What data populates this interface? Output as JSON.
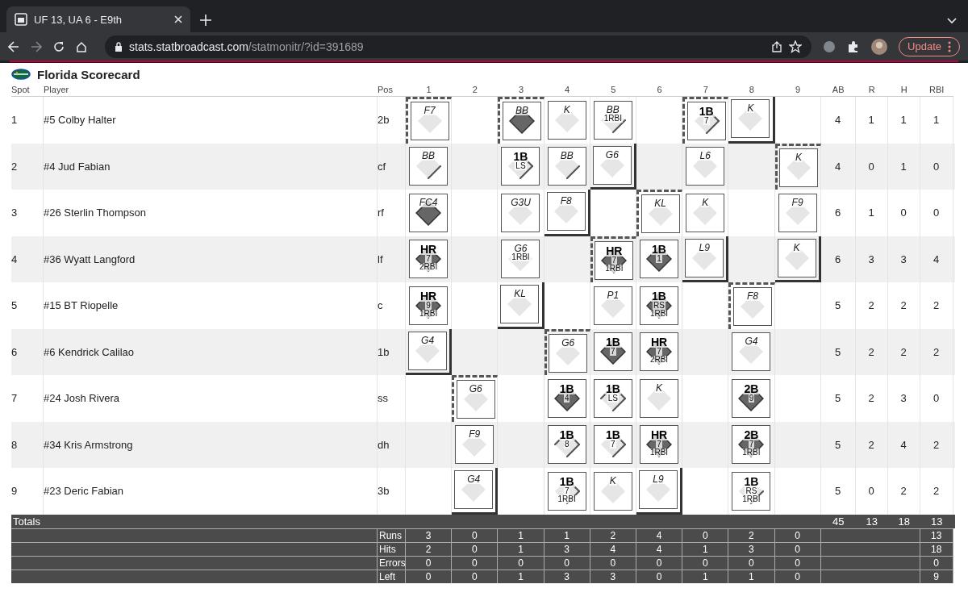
{
  "browser": {
    "tab_title": "UF 13, UA 6 - E9th",
    "url_host": "stats.statbroadcast.com",
    "url_path": "/statmonitr/?id=391689",
    "update_label": "Update"
  },
  "scorecard": {
    "title": "Florida Scorecard",
    "columns": [
      "Spot",
      "Player",
      "Pos",
      "1",
      "2",
      "3",
      "4",
      "5",
      "6",
      "7",
      "8",
      "9",
      "AB",
      "R",
      "H",
      "RBI"
    ],
    "rows": [
      {
        "spot": "1",
        "player": "#5 Colby Halter",
        "pos": "2b",
        "ab": "4",
        "r": "1",
        "h": "1",
        "rbi": "1",
        "innings": [
          {
            "kind": "out",
            "result": "F7",
            "scored": false,
            "leadoff": true,
            "third_out": false
          },
          {
            "kind": "empty",
            "leadoff": false,
            "third_out": false
          },
          {
            "kind": "walk",
            "result": "BB",
            "scored": true,
            "leadoff": true,
            "third_out": false
          },
          {
            "kind": "out",
            "result": "K",
            "scored": false,
            "leadoff": false,
            "third_out": false
          },
          {
            "kind": "walk",
            "result": "BB",
            "lines": [
              "1RBI"
            ],
            "to_first": true,
            "to_second": false,
            "to_third": false,
            "scored": false,
            "leadoff": false,
            "third_out": false
          },
          {
            "kind": "empty",
            "leadoff": false,
            "third_out": false
          },
          {
            "kind": "hit",
            "result": "1B",
            "lines": [
              "7"
            ],
            "to_first": true,
            "to_second": true,
            "to_third": false,
            "scored": false,
            "leadoff": true,
            "third_out": false
          },
          {
            "kind": "out",
            "result": "K",
            "scored": false,
            "leadoff": false,
            "third_out": true
          },
          {
            "kind": "empty",
            "leadoff": false,
            "third_out": false
          }
        ]
      },
      {
        "spot": "2",
        "player": "#4 Jud Fabian",
        "pos": "cf",
        "ab": "4",
        "r": "0",
        "h": "1",
        "rbi": "0",
        "innings": [
          {
            "kind": "walk",
            "result": "BB",
            "to_first": true,
            "to_second": false,
            "to_third": false,
            "scored": false,
            "leadoff": false,
            "third_out": false
          },
          {
            "kind": "empty",
            "leadoff": false,
            "third_out": false
          },
          {
            "kind": "hit",
            "result": "1B",
            "lines": [
              "LS"
            ],
            "to_first": true,
            "to_second": true,
            "to_third": false,
            "scored": false,
            "leadoff": false,
            "third_out": false
          },
          {
            "kind": "walk",
            "result": "BB",
            "to_first": true,
            "to_second": false,
            "to_third": false,
            "scored": false,
            "leadoff": false,
            "third_out": false
          },
          {
            "kind": "out",
            "result": "G6",
            "scored": false,
            "leadoff": false,
            "third_out": true
          },
          {
            "kind": "empty",
            "leadoff": false,
            "third_out": false
          },
          {
            "kind": "out",
            "result": "L6",
            "scored": false,
            "leadoff": false,
            "third_out": false
          },
          {
            "kind": "empty",
            "leadoff": false,
            "third_out": false
          },
          {
            "kind": "out",
            "result": "K",
            "scored": false,
            "leadoff": true,
            "third_out": false
          }
        ]
      },
      {
        "spot": "3",
        "player": "#26 Sterlin Thompson",
        "pos": "rf",
        "ab": "6",
        "r": "1",
        "h": "0",
        "rbi": "0",
        "innings": [
          {
            "kind": "out",
            "result": "FC4",
            "scored": true,
            "leadoff": false,
            "third_out": false
          },
          {
            "kind": "empty",
            "leadoff": false,
            "third_out": false
          },
          {
            "kind": "out",
            "result": "G3U",
            "scored": false,
            "leadoff": false,
            "third_out": false
          },
          {
            "kind": "out",
            "result": "F8",
            "scored": false,
            "leadoff": false,
            "third_out": true
          },
          {
            "kind": "empty",
            "leadoff": false,
            "third_out": false
          },
          {
            "kind": "out",
            "result": "KL",
            "scored": false,
            "leadoff": true,
            "third_out": false
          },
          {
            "kind": "out",
            "result": "K",
            "scored": false,
            "leadoff": false,
            "third_out": false
          },
          {
            "kind": "empty",
            "leadoff": false,
            "third_out": false
          },
          {
            "kind": "out",
            "result": "F9",
            "scored": false,
            "leadoff": false,
            "third_out": false
          }
        ]
      },
      {
        "spot": "4",
        "player": "#36 Wyatt Langford",
        "pos": "lf",
        "ab": "6",
        "r": "3",
        "h": "3",
        "rbi": "4",
        "innings": [
          {
            "kind": "hit",
            "result": "HR",
            "lines": [
              "7",
              "2RBI"
            ],
            "scored": true,
            "leadoff": false,
            "third_out": false
          },
          {
            "kind": "empty",
            "leadoff": false,
            "third_out": false
          },
          {
            "kind": "out",
            "result": "G6",
            "lines": [
              "1RBI"
            ],
            "scored": false,
            "leadoff": false,
            "third_out": false
          },
          {
            "kind": "empty",
            "leadoff": false,
            "third_out": false
          },
          {
            "kind": "hit",
            "result": "HR",
            "lines": [
              "7",
              "1RBI"
            ],
            "scored": true,
            "leadoff": true,
            "third_out": false
          },
          {
            "kind": "hit",
            "result": "1B",
            "lines": [
              "1"
            ],
            "scored": true,
            "leadoff": false,
            "third_out": false
          },
          {
            "kind": "out",
            "result": "L9",
            "scored": false,
            "leadoff": false,
            "third_out": true
          },
          {
            "kind": "empty",
            "leadoff": false,
            "third_out": false
          },
          {
            "kind": "out",
            "result": "K",
            "scored": false,
            "leadoff": false,
            "third_out": true
          }
        ]
      },
      {
        "spot": "5",
        "player": "#15 BT Riopelle",
        "pos": "c",
        "ab": "5",
        "r": "2",
        "h": "2",
        "rbi": "2",
        "innings": [
          {
            "kind": "hit",
            "result": "HR",
            "lines": [
              "9",
              "1RBI"
            ],
            "scored": true,
            "leadoff": false,
            "third_out": false
          },
          {
            "kind": "empty",
            "leadoff": false,
            "third_out": false
          },
          {
            "kind": "out",
            "result": "KL",
            "scored": false,
            "leadoff": false,
            "third_out": true
          },
          {
            "kind": "empty",
            "leadoff": false,
            "third_out": false
          },
          {
            "kind": "out",
            "result": "P1",
            "scored": false,
            "leadoff": false,
            "third_out": false
          },
          {
            "kind": "hit",
            "result": "1B",
            "lines": [
              "RS",
              "1RBI"
            ],
            "scored": true,
            "leadoff": false,
            "third_out": false
          },
          {
            "kind": "empty",
            "leadoff": false,
            "third_out": false
          },
          {
            "kind": "out",
            "result": "F8",
            "scored": false,
            "leadoff": true,
            "third_out": false
          },
          {
            "kind": "empty",
            "leadoff": false,
            "third_out": false
          }
        ]
      },
      {
        "spot": "6",
        "player": "#6 Kendrick Calilao",
        "pos": "1b",
        "ab": "5",
        "r": "2",
        "h": "2",
        "rbi": "2",
        "innings": [
          {
            "kind": "out",
            "result": "G4",
            "scored": false,
            "leadoff": false,
            "third_out": true
          },
          {
            "kind": "empty",
            "leadoff": false,
            "third_out": false
          },
          {
            "kind": "empty",
            "leadoff": false,
            "third_out": false
          },
          {
            "kind": "out",
            "result": "G6",
            "scored": false,
            "leadoff": true,
            "third_out": false
          },
          {
            "kind": "hit",
            "result": "1B",
            "lines": [
              "7"
            ],
            "scored": true,
            "leadoff": false,
            "third_out": false
          },
          {
            "kind": "hit",
            "result": "HR",
            "lines": [
              "7",
              "2RBI"
            ],
            "scored": true,
            "leadoff": false,
            "third_out": false
          },
          {
            "kind": "empty",
            "leadoff": false,
            "third_out": false
          },
          {
            "kind": "out",
            "result": "G4",
            "scored": false,
            "leadoff": false,
            "third_out": false
          },
          {
            "kind": "empty",
            "leadoff": false,
            "third_out": false
          }
        ]
      },
      {
        "spot": "7",
        "player": "#24 Josh Rivera",
        "pos": "ss",
        "ab": "5",
        "r": "2",
        "h": "3",
        "rbi": "0",
        "innings": [
          {
            "kind": "empty",
            "leadoff": false,
            "third_out": false
          },
          {
            "kind": "out",
            "result": "G6",
            "scored": false,
            "leadoff": true,
            "third_out": false
          },
          {
            "kind": "empty",
            "leadoff": false,
            "third_out": false
          },
          {
            "kind": "hit",
            "result": "1B",
            "lines": [
              "4"
            ],
            "scored": true,
            "leadoff": false,
            "third_out": false
          },
          {
            "kind": "hit",
            "result": "1B",
            "lines": [
              "LS"
            ],
            "to_first": true,
            "to_second": true,
            "to_third": true,
            "scored": false,
            "leadoff": false,
            "third_out": false
          },
          {
            "kind": "out",
            "result": "K",
            "scored": false,
            "leadoff": false,
            "third_out": false
          },
          {
            "kind": "empty",
            "leadoff": false,
            "third_out": false
          },
          {
            "kind": "hit",
            "result": "2B",
            "lines": [
              "9"
            ],
            "scored": true,
            "leadoff": false,
            "third_out": false
          },
          {
            "kind": "empty",
            "leadoff": false,
            "third_out": false
          }
        ]
      },
      {
        "spot": "8",
        "player": "#34 Kris Armstrong",
        "pos": "dh",
        "ab": "5",
        "r": "2",
        "h": "4",
        "rbi": "2",
        "innings": [
          {
            "kind": "empty",
            "leadoff": false,
            "third_out": false
          },
          {
            "kind": "out",
            "result": "F9",
            "scored": false,
            "leadoff": false,
            "third_out": false
          },
          {
            "kind": "empty",
            "leadoff": false,
            "third_out": false
          },
          {
            "kind": "hit",
            "result": "1B",
            "lines": [
              "8"
            ],
            "to_first": true,
            "to_second": true,
            "to_third": true,
            "scored": false,
            "leadoff": false,
            "third_out": false
          },
          {
            "kind": "hit",
            "result": "1B",
            "lines": [
              "7"
            ],
            "to_first": true,
            "to_second": true,
            "to_third": false,
            "scored": false,
            "leadoff": false,
            "third_out": false
          },
          {
            "kind": "hit",
            "result": "HR",
            "lines": [
              "7",
              "1RBI"
            ],
            "scored": true,
            "leadoff": false,
            "third_out": false
          },
          {
            "kind": "empty",
            "leadoff": false,
            "third_out": false
          },
          {
            "kind": "hit",
            "result": "2B",
            "lines": [
              "7",
              "1RBI"
            ],
            "scored": true,
            "leadoff": false,
            "third_out": false
          },
          {
            "kind": "empty",
            "leadoff": false,
            "third_out": false
          }
        ]
      },
      {
        "spot": "9",
        "player": "#23 Deric Fabian",
        "pos": "3b",
        "ab": "5",
        "r": "0",
        "h": "2",
        "rbi": "2",
        "innings": [
          {
            "kind": "empty",
            "leadoff": false,
            "third_out": false
          },
          {
            "kind": "out",
            "result": "G4",
            "scored": false,
            "leadoff": false,
            "third_out": true
          },
          {
            "kind": "empty",
            "leadoff": false,
            "third_out": false
          },
          {
            "kind": "hit",
            "result": "1B",
            "lines": [
              "7",
              "1RBI"
            ],
            "to_first": true,
            "to_second": true,
            "to_third": false,
            "scored": false,
            "leadoff": false,
            "third_out": false
          },
          {
            "kind": "out",
            "result": "K",
            "scored": false,
            "leadoff": false,
            "third_out": false
          },
          {
            "kind": "out",
            "result": "L9",
            "scored": false,
            "leadoff": false,
            "third_out": true
          },
          {
            "kind": "empty",
            "leadoff": false,
            "third_out": false
          },
          {
            "kind": "hit",
            "result": "1B",
            "lines": [
              "RS",
              "1RBI"
            ],
            "to_first": true,
            "to_second": false,
            "to_third": false,
            "scored": false,
            "leadoff": false,
            "third_out": false
          },
          {
            "kind": "empty",
            "leadoff": false,
            "third_out": false
          }
        ]
      }
    ],
    "totals": {
      "label": "Totals",
      "ab": "45",
      "r": "13",
      "h": "18",
      "rbi": "13"
    },
    "line_score": [
      {
        "label": "Runs",
        "values": [
          "3",
          "0",
          "1",
          "1",
          "2",
          "4",
          "0",
          "2",
          "0"
        ],
        "total": "13"
      },
      {
        "label": "Hits",
        "values": [
          "2",
          "0",
          "1",
          "3",
          "4",
          "4",
          "1",
          "3",
          "0"
        ],
        "total": "18"
      },
      {
        "label": "Errors",
        "values": [
          "0",
          "0",
          "0",
          "0",
          "0",
          "0",
          "0",
          "0",
          "0"
        ],
        "total": "0"
      },
      {
        "label": "Left",
        "values": [
          "0",
          "0",
          "1",
          "3",
          "3",
          "0",
          "1",
          "1",
          "0"
        ],
        "total": "9"
      }
    ]
  }
}
